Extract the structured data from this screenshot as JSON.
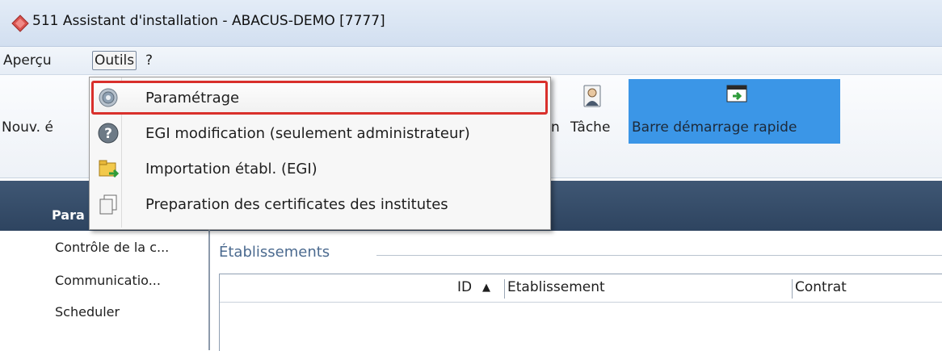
{
  "window": {
    "title": "511 Assistant d'installation - ABACUS-DEMO [7777]",
    "title_icon": "diamond-logo-icon"
  },
  "menubar": {
    "apercu": "Aperçu",
    "outils": "Outils",
    "help": "?"
  },
  "ribbon": {
    "nouv_partial": "Nouv. é",
    "hidden_partial": "n",
    "tache": "Tâche",
    "barre": "Barre démarrage rapide",
    "barre_color": "#3b96e7"
  },
  "dropdown": {
    "items": [
      {
        "label": "Paramétrage",
        "icon": "gear-icon",
        "highlighted": true
      },
      {
        "label": "EGI modification (seulement administrateur)",
        "icon": "help-circle-icon"
      },
      {
        "label": "Importation établ. (EGI)",
        "icon": "import-folder-icon"
      },
      {
        "label": "Preparation des certificates des institutes",
        "icon": "copy-documents-icon"
      }
    ],
    "highlight_color": "#d9302c"
  },
  "left_panel": {
    "header_partial": "Para",
    "items": [
      "Contrôle de la c...",
      "Communicatio...",
      "Scheduler"
    ]
  },
  "main": {
    "group_title": "Établissements",
    "columns": [
      "ID",
      "Etablissement",
      "Contrat"
    ],
    "sort_indicator": "▲"
  }
}
